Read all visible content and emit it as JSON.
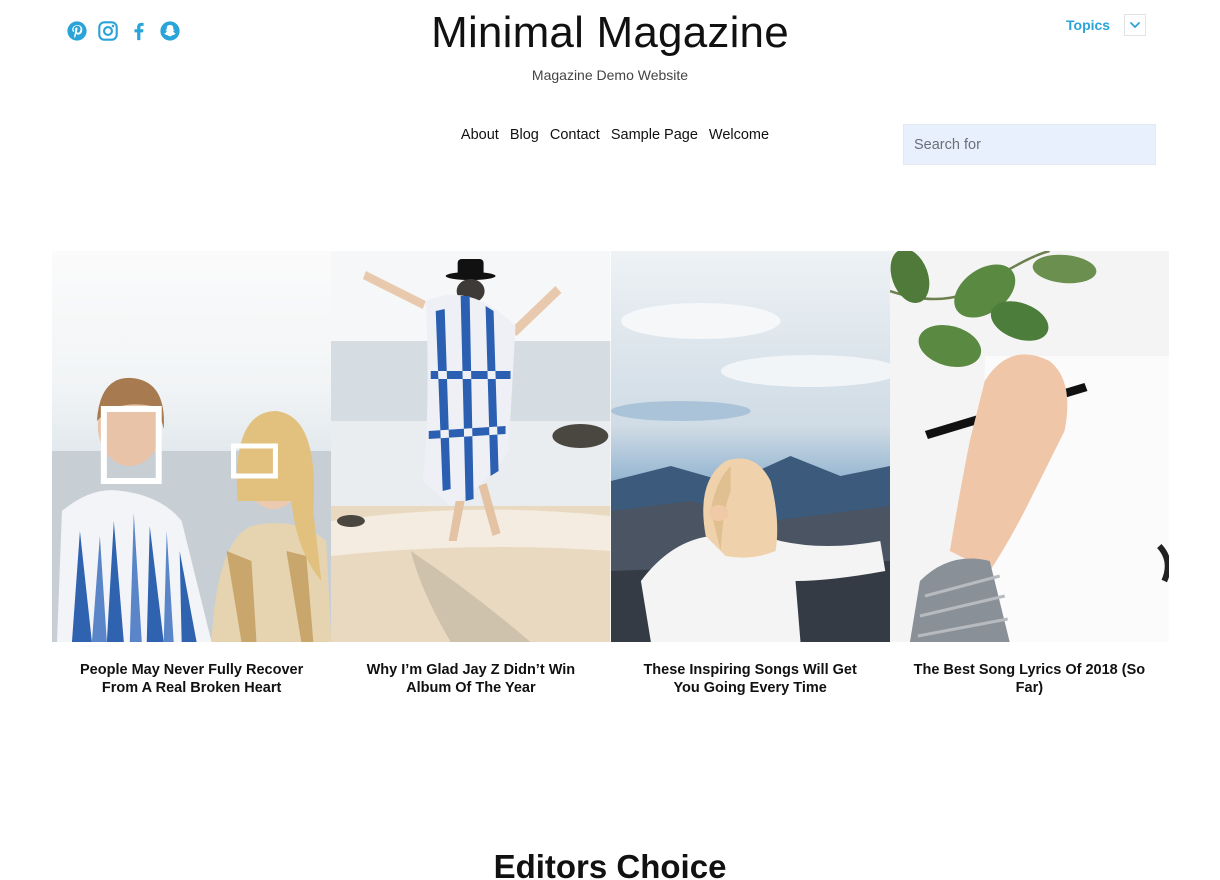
{
  "brand": {
    "accent": "#2aa3d8",
    "title": "Minimal Magazine",
    "tagline": "Magazine Demo Website"
  },
  "social": [
    {
      "icon": "pinterest-icon"
    },
    {
      "icon": "instagram-icon"
    },
    {
      "icon": "facebook-icon"
    },
    {
      "icon": "snapchat-icon"
    }
  ],
  "topics": {
    "label": "Topics",
    "toggle_icon": "chevron-down-icon"
  },
  "nav": {
    "items": [
      "About",
      "Blog",
      "Contact",
      "Sample Page",
      "Welcome"
    ]
  },
  "search": {
    "placeholder": "Search for",
    "value": ""
  },
  "featured": [
    {
      "title": "People May Never Fully Recover From A Real Broken Heart",
      "image": "two women on beach holding frames"
    },
    {
      "title": "Why I’m Glad Jay Z Didn’t Win Album Of The Year",
      "image": "woman in blue dress on beach"
    },
    {
      "title": "These Inspiring Songs Will Get You Going Every Time",
      "image": "blonde woman facing mountains"
    },
    {
      "title": "The Best Song Lyrics Of 2018 (So Far)",
      "image": "hand writing with pen near leaves"
    }
  ],
  "sections": {
    "editors_choice": "Editors Choice"
  }
}
